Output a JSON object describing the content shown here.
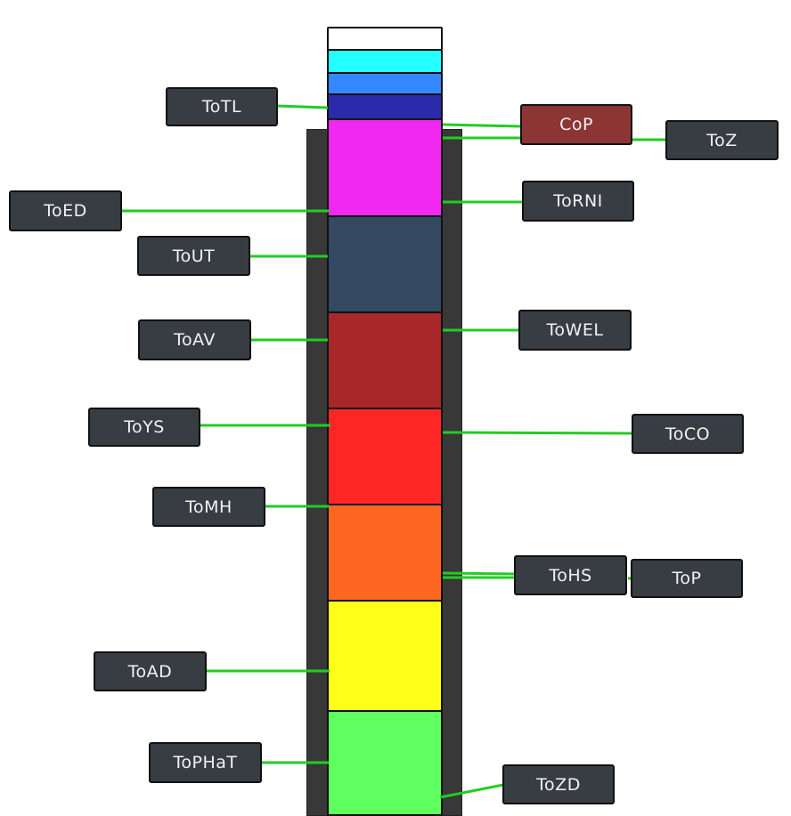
{
  "diagram": {
    "title": "",
    "connector_color": "#22cc22",
    "column_color": "#383838",
    "label_bg": "#383c43",
    "layers": [
      {
        "id": "white",
        "color": "#ffffff"
      },
      {
        "id": "cyan",
        "color": "#22ffff"
      },
      {
        "id": "lightblue",
        "color": "#3388ff"
      },
      {
        "id": "navy",
        "color": "#2a2aaa"
      },
      {
        "id": "magenta",
        "color": "#f028f0"
      },
      {
        "id": "slate",
        "color": "#344a62"
      },
      {
        "id": "darkred",
        "color": "#a8282a"
      },
      {
        "id": "red",
        "color": "#ff2626"
      },
      {
        "id": "orange",
        "color": "#ff6622"
      },
      {
        "id": "yellow",
        "color": "#ffff1a"
      },
      {
        "id": "green",
        "color": "#5fff5f"
      }
    ],
    "labels": {
      "totl": "ToTL",
      "toed": "ToED",
      "tout": "ToUT",
      "toav": "ToAV",
      "toys": "ToYS",
      "tomh": "ToMH",
      "toad": "ToAD",
      "tophat": "ToPHaT",
      "cop": "CoP",
      "toz": "ToZ",
      "torni": "ToRNI",
      "towel": "ToWEL",
      "toco": "ToCO",
      "tohs": "ToHS",
      "top": "ToP",
      "tozd": "ToZD"
    },
    "cop_color": "#8b3535"
  }
}
